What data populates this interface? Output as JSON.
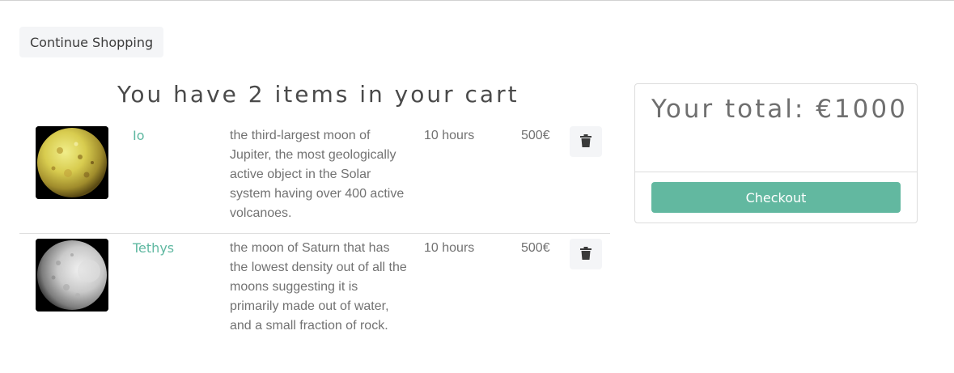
{
  "nav": {
    "continue_label": "Continue Shopping"
  },
  "cart": {
    "heading": "You have 2 items in your cart",
    "items": [
      {
        "name": "Io",
        "description": "the third-largest moon of Jupiter, the most geologically active object in the Solar system having over 400 active volcanoes.",
        "duration": "10 hours",
        "price": "500€",
        "image": "io-moon-image"
      },
      {
        "name": "Tethys",
        "description": "the moon of Saturn that has the lowest density out of all the moons suggesting it is primarily made out of water, and a small fraction of rock.",
        "duration": "10 hours",
        "price": "500€",
        "image": "tethys-moon-image"
      }
    ]
  },
  "summary": {
    "total_label": "Your total: €1000",
    "checkout_label": "Checkout"
  },
  "colors": {
    "accent": "#62b8a0",
    "link": "#5fb8a1",
    "button_bg": "#f4f5f7"
  },
  "icons": {
    "delete": "trash-icon"
  }
}
